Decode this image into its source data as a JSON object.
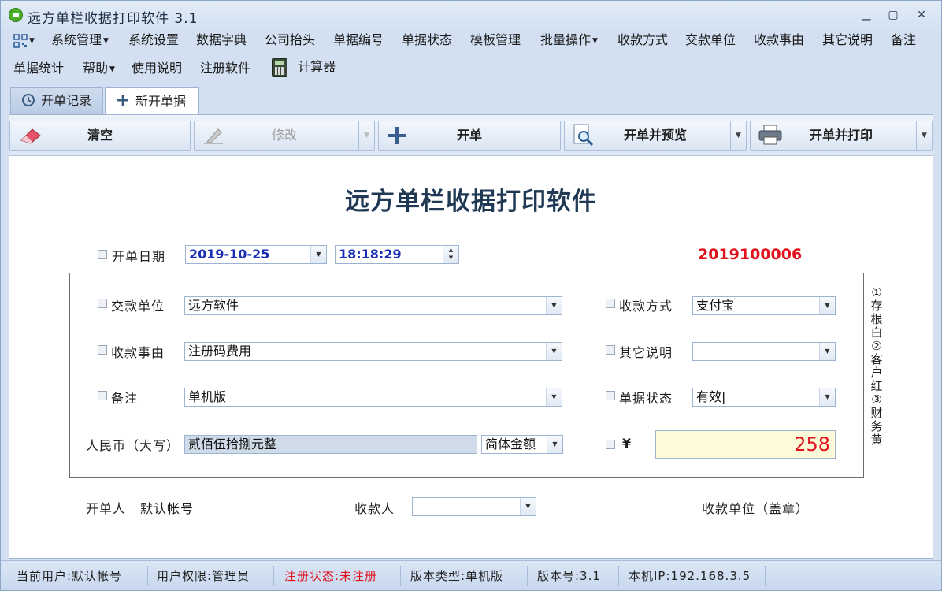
{
  "window": {
    "title": "远方单栏收据打印软件 3.1",
    "minimize": "▁",
    "maximize": "▢",
    "close": "✕"
  },
  "menu": {
    "items": [
      "系统管理",
      "系统设置",
      "数据字典",
      "公司抬头",
      "单据编号",
      "单据状态",
      "模板管理",
      "批量操作",
      "收款方式",
      "交款单位",
      "收款事由",
      "其它说明",
      "备注",
      "单据统计",
      "帮助",
      "使用说明",
      "注册软件",
      "计算器"
    ]
  },
  "tabs": [
    {
      "label": "开单记录",
      "icon": "history-icon"
    },
    {
      "label": "新开单据",
      "icon": "plus-icon"
    }
  ],
  "toolbar": {
    "clear": "清空",
    "edit": "修改",
    "create": "开单",
    "create_preview": "开单并预览",
    "create_print": "开单并打印"
  },
  "form": {
    "title": "远方单栏收据打印软件",
    "date_label": "开单日期",
    "date": "2019-10-25",
    "time": "18:18:29",
    "receipt_no": "2019100006",
    "payer_label": "交款单位",
    "payer": "远方软件",
    "method_label": "收款方式",
    "method": "支付宝",
    "reason_label": "收款事由",
    "reason": "注册码费用",
    "other_label": "其它说明",
    "other": "",
    "remark_label": "备注",
    "remark": "单机版",
    "status_label": "单据状态",
    "status": "有效|",
    "rmb_label": "人民币（大写）",
    "rmb_upper": "贰佰伍拾捌元整",
    "amount_format": "简体金额",
    "currency_symbol": "¥",
    "amount": "258",
    "side_note": "①存根白②客户红③财务黄",
    "issuer_label": "开单人",
    "issuer": "默认帐号",
    "payee_label": "收款人",
    "payee": "",
    "stamp_label": "收款单位（盖章）"
  },
  "statusbar": {
    "user": "当前用户:默认帐号",
    "role": "用户权限:管理员",
    "reg": "注册状态:未注册",
    "edition": "版本类型:单机版",
    "version": "版本号:3.1",
    "ip": "本机IP:192.168.3.5"
  },
  "colors": {
    "accent": "#e0121d",
    "date_text": "#1b2fb5",
    "amount_bg": "#fdfbd9"
  }
}
